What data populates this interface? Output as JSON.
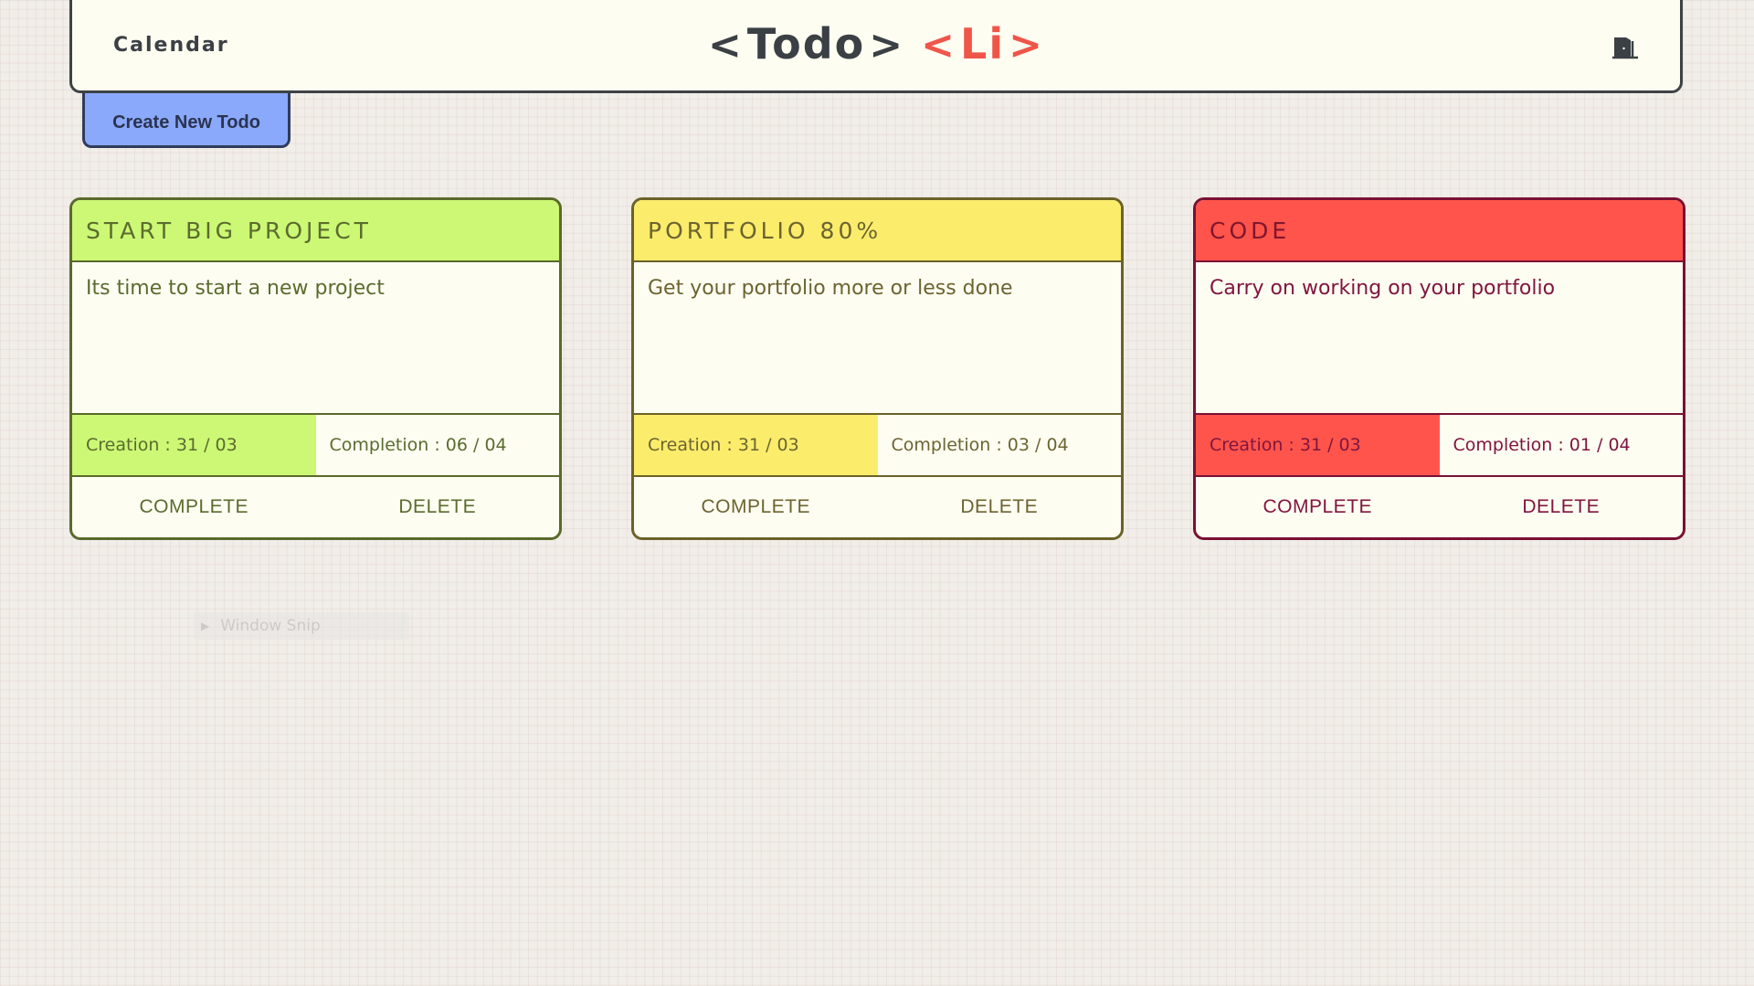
{
  "header": {
    "nav_left": "Calendar",
    "logo": {
      "part1_open": "<",
      "part1_text": "Todo",
      "part1_close": ">",
      "part2_open": "<",
      "part2_text": "Li",
      "part2_close": ">"
    },
    "logout_icon": "door-exit-icon"
  },
  "create_button": {
    "label": "Create New Todo"
  },
  "todos": [
    {
      "title": "START BIG PROJECT",
      "description": "Its time to start a new project",
      "creation": "Creation : 31 / 03",
      "completion": "Completion : 06 / 04",
      "complete_label": "COMPLETE",
      "delete_label": "DELETE",
      "color": "#ccf875"
    },
    {
      "title": "PORTFOLIO 80%",
      "description": "Get your portfolio more or less done",
      "creation": "Creation : 31 / 03",
      "completion": "Completion : 03 / 04",
      "complete_label": "COMPLETE",
      "delete_label": "DELETE",
      "color": "#fbec6c"
    },
    {
      "title": "CODE",
      "description": "Carry on working on your portfolio",
      "creation": "Creation : 31 / 03",
      "completion": "Completion : 01 / 04",
      "complete_label": "COMPLETE",
      "delete_label": "DELETE",
      "color": "#ff544b"
    }
  ],
  "overlay": {
    "snip_label": "Window Snip"
  },
  "colors": {
    "background": "#f1ede8",
    "header_bg": "#fefdf2",
    "create_button_bg": "#8aa9fb",
    "logo_accent": "#f0554a"
  }
}
